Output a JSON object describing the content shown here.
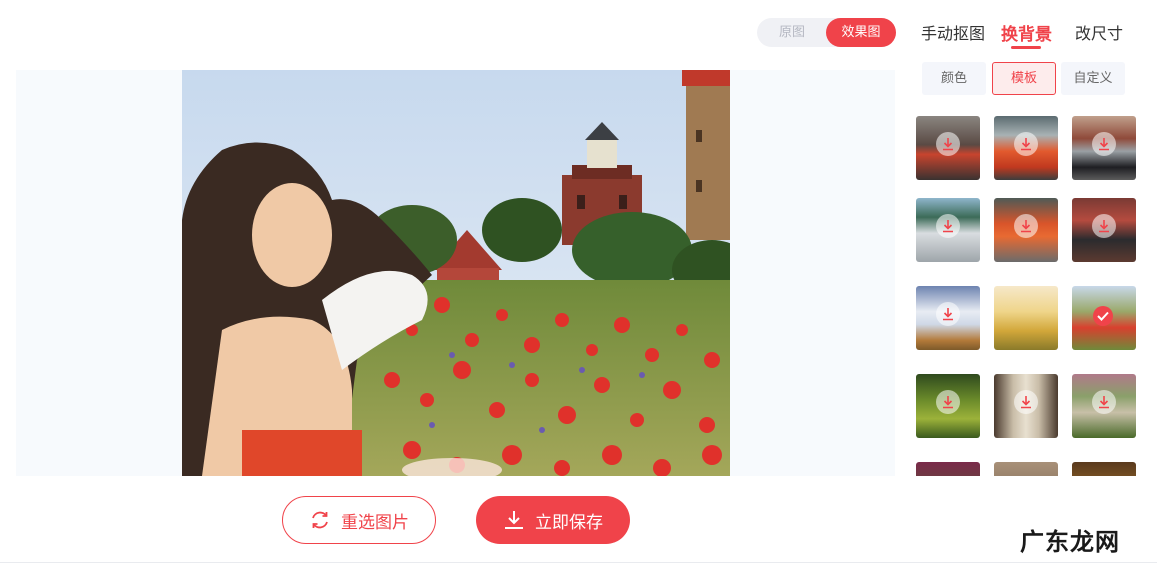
{
  "view_toggle": {
    "original_label": "原图",
    "result_label": "效果图",
    "selected": "效果图"
  },
  "tabs": [
    {
      "label": "手动抠图",
      "active": false
    },
    {
      "label": "换背景",
      "active": true
    },
    {
      "label": "改尺寸",
      "active": false
    }
  ],
  "subtabs": [
    {
      "label": "颜色",
      "active": false
    },
    {
      "label": "模板",
      "active": true
    },
    {
      "label": "自定义",
      "active": false
    }
  ],
  "actions": {
    "reselect_label": "重选图片",
    "save_label": "立即保存"
  },
  "templates": [
    {
      "name": "car-street",
      "selected": false
    },
    {
      "name": "orange-car",
      "selected": false
    },
    {
      "name": "dark-car",
      "selected": false
    },
    {
      "name": "beach-car",
      "selected": false
    },
    {
      "name": "rainy-car",
      "selected": false
    },
    {
      "name": "motorbike",
      "selected": false
    },
    {
      "name": "snow-tree",
      "selected": false
    },
    {
      "name": "tulips",
      "selected": false
    },
    {
      "name": "poppy-field",
      "selected": true
    },
    {
      "name": "forest",
      "selected": false
    },
    {
      "name": "stairs",
      "selected": false
    },
    {
      "name": "garden-path",
      "selected": false
    }
  ],
  "watermark": "广东龙网",
  "colors": {
    "accent": "#f0434a"
  }
}
